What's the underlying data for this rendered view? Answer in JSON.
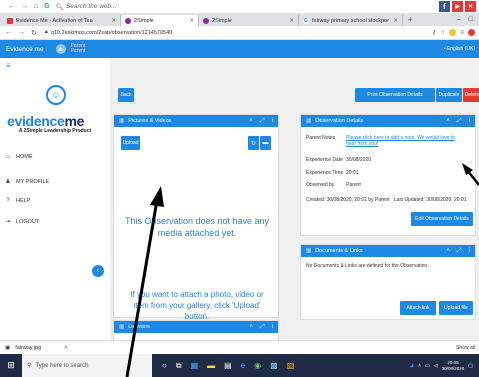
{
  "system": {
    "search_placeholder": "Search the web..."
  },
  "tabs": [
    {
      "label": "Evidence Me - Activation of Tea",
      "color": "#e53935"
    },
    {
      "label": "2Simple",
      "color": "#8e24aa"
    },
    {
      "label": "2Simple",
      "color": "#8e24aa"
    },
    {
      "label": "fairway primary school stockpor",
      "color": "#4285f4"
    }
  ],
  "address": {
    "url": "q10.2eskimos.com/2sap/observation/12145705​40"
  },
  "header": {
    "brand": "Evidence me",
    "user_line1": "Parent",
    "user_line2": "Parent",
    "language": "English (UK)"
  },
  "sidebar": {
    "logo_ev": "evidence",
    "logo_me": "me",
    "tagline": "A 2Simple Leadership Product",
    "items": [
      {
        "label": "HOME",
        "icon": "home-icon",
        "glyph": "⌂"
      },
      {
        "label": "MY PROFILE",
        "icon": "person-icon",
        "glyph": "♟"
      },
      {
        "label": "HELP",
        "icon": "help-icon",
        "glyph": "?"
      },
      {
        "label": "LOGOUT",
        "icon": "logout-icon",
        "glyph": "⇥"
      }
    ]
  },
  "toolbar": {
    "back": "Back",
    "print": "Print Observation Details",
    "duplicate": "Duplicate",
    "delete": "Delete"
  },
  "media_panel": {
    "title": "Pictures & Videos",
    "upload": "Upload",
    "empty_message": "This Observation does not have any media attached yet.",
    "upload_hint": "If you want to attach a photo, video or item from your gallery, click 'Upload' button."
  },
  "learners_panel": {
    "title": "Learners"
  },
  "details_panel": {
    "title": "Observation Details",
    "parent_notes_label": "Parent Notes",
    "parent_notes_link": "Please click here to add a note. We would love to hear from you!",
    "experience_date_label": "Experience Date",
    "experience_date": "30/08/2020",
    "experience_time_label": "Experience Time",
    "experience_time": "20:01",
    "observed_by_label": "Observed by",
    "observed_by": "Parent",
    "created_line": "Created: 30/08/2020, 20:01 by Parent",
    "last_updated_line": "Last Updated: 30/08/2020, 20:01",
    "edit_button": "Edit Observation Details"
  },
  "docs_panel": {
    "title": "Documents & Links",
    "empty": "No Documents & Links are defined for the Observation.",
    "attach": "Attach link",
    "upload": "Upload file"
  },
  "downloads": {
    "file": "fairway.jpg",
    "show_all": "Show all"
  },
  "taskbar": {
    "search": "Type here to search",
    "time": "20:05",
    "date": "30/08/2020"
  },
  "colors": {
    "accent": "#1e88e5",
    "danger": "#e53935",
    "taskbar": "#1f2a44"
  }
}
